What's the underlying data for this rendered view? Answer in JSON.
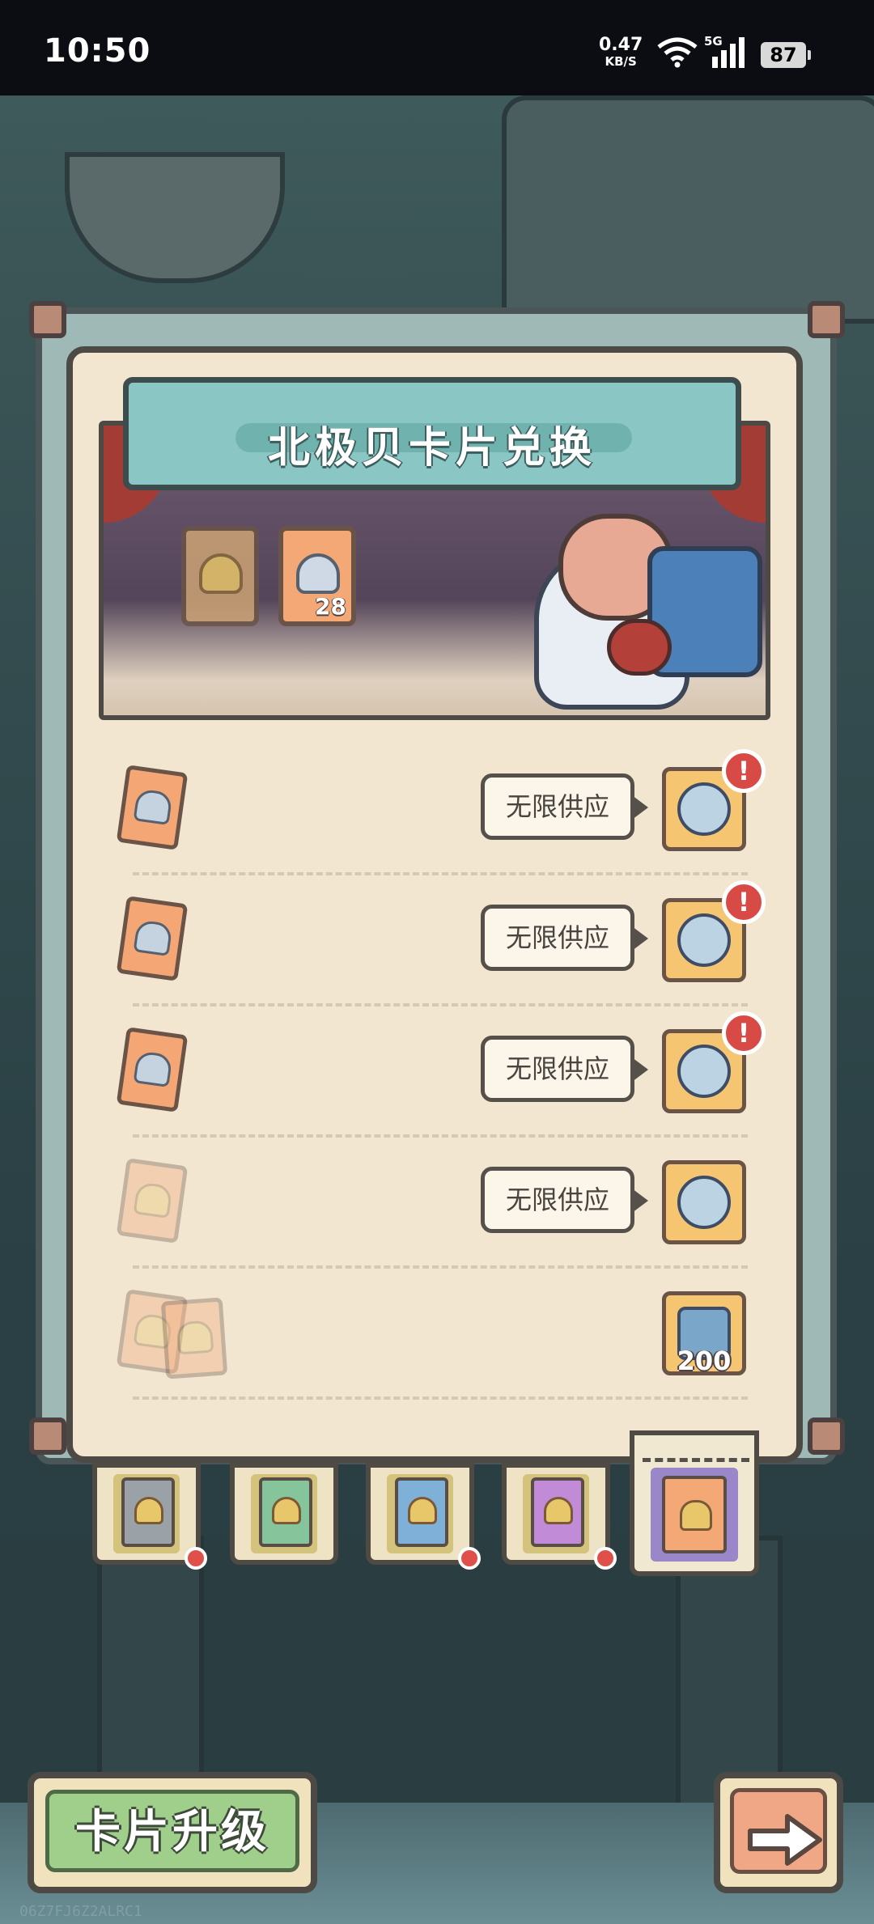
{
  "status_bar": {
    "time": "10:50",
    "net_speed": "0.47",
    "net_unit": "KB/S",
    "network_type": "5G",
    "battery": "87",
    "icons": [
      "wifi-icon",
      "signal-icon",
      "battery-icon"
    ]
  },
  "panel": {
    "title": "北极贝卡片兑换",
    "showcase": {
      "cards": [
        {
          "state": "empty",
          "count": ""
        },
        {
          "state": "owned",
          "count": "28"
        }
      ]
    }
  },
  "exchange_rows": [
    {
      "cost_cards": 1,
      "cost_faded": false,
      "supply_label": "无限供应",
      "reward_icon": "ornate-shell-icon",
      "reward_qty": "",
      "alert": true
    },
    {
      "cost_cards": 1,
      "cost_faded": false,
      "supply_label": "无限供应",
      "reward_icon": "ornate-shell-icon",
      "reward_qty": "",
      "alert": true
    },
    {
      "cost_cards": 1,
      "cost_faded": false,
      "supply_label": "无限供应",
      "reward_icon": "ornate-shell-icon",
      "reward_qty": "",
      "alert": true
    },
    {
      "cost_cards": 1,
      "cost_faded": true,
      "supply_label": "无限供应",
      "reward_icon": "ornate-shell-icon",
      "reward_qty": "",
      "alert": false
    },
    {
      "cost_cards": 2,
      "cost_faded": true,
      "supply_label": "",
      "reward_icon": "treasure-chest-icon",
      "reward_qty": "200",
      "alert": false
    }
  ],
  "alert_symbol": "!",
  "card_tabs": [
    {
      "color": "#9aa2a8",
      "has_dot": true,
      "active": false
    },
    {
      "color": "#86c59b",
      "has_dot": false,
      "active": false
    },
    {
      "color": "#7fb0d8",
      "has_dot": true,
      "active": false
    },
    {
      "color": "#c28bd8",
      "has_dot": true,
      "active": false
    },
    {
      "color": "#f3a875",
      "has_dot": false,
      "active": true
    }
  ],
  "buttons": {
    "upgrade_label": "卡片升级",
    "next_icon": "arrow-right-icon"
  },
  "watermark": "06Z7FJ6Z2ALRC1",
  "colors": {
    "panel_bg": "#f2e6d0",
    "title_bg": "#8ac7c4",
    "alert_red": "#d84a45",
    "upgrade_green": "#9fcf8b",
    "next_orange": "#f0a785"
  }
}
